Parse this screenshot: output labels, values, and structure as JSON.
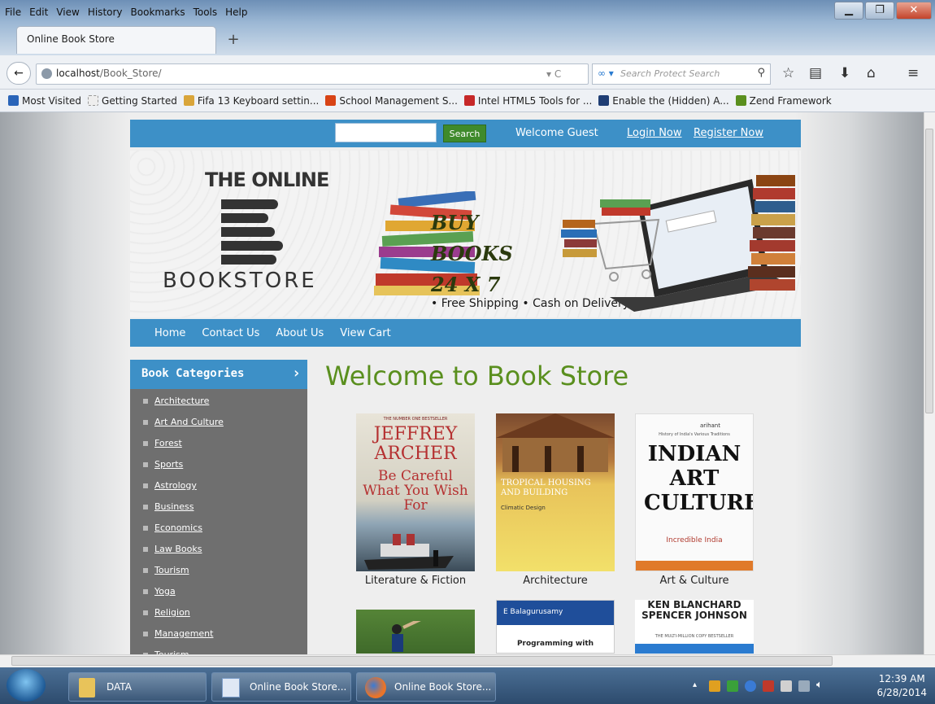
{
  "browser": {
    "menu": [
      "File",
      "Edit",
      "View",
      "History",
      "Bookmarks",
      "Tools",
      "Help"
    ],
    "tab_title": "Online Book Store",
    "url_host": "localhost",
    "url_path": "/Book_Store/",
    "search_placeholder": "Search Protect Search",
    "bookmarks": [
      {
        "label": "Most Visited",
        "color": "#2a64b8"
      },
      {
        "label": "Getting Started",
        "color": "#eeeeee"
      },
      {
        "label": "Fifa 13 Keyboard settin...",
        "color": "#d9a53a"
      },
      {
        "label": "School Management S...",
        "color": "#d84315"
      },
      {
        "label": "Intel HTML5 Tools for ...",
        "color": "#c62828"
      },
      {
        "label": "Enable the (Hidden) A...",
        "color": "#1f3e74"
      },
      {
        "label": "Zend Framework",
        "color": "#5a8f1e"
      }
    ]
  },
  "site": {
    "search_button": "Search",
    "welcome": "Welcome Guest",
    "login": "Login Now",
    "register": "Register Now",
    "logo_top": "THE ONLINE",
    "logo_bottom": "BOOKSTORE",
    "slogan": [
      "BUY",
      "BOOKS",
      "24 X 7"
    ],
    "shipping": "• Free Shipping  • Cash on Delivery",
    "nav": [
      "Home",
      "Contact Us",
      "About Us",
      "View Cart"
    ],
    "categories_title": "Book Categories",
    "categories": [
      "Architecture",
      "Art And Culture",
      "Forest",
      "Sports",
      "Astrology",
      "Business",
      "Economics",
      "Law Books",
      "Tourism",
      "Yoga",
      "Religion",
      "Management",
      "Tourism"
    ],
    "welcome_title": "Welcome to Book Store",
    "books": [
      {
        "caption": "Literature & Fiction",
        "cover_author": "JEFFREY ARCHER",
        "cover_title": "Be Careful What You Wish For",
        "cover_top": "THE NUMBER ONE BESTSELLER"
      },
      {
        "caption": "Architecture",
        "cover_title": "TROPICAL HOUSING AND BUILDING",
        "cover_sub": "Climatic Design"
      },
      {
        "caption": "Art & Culture",
        "cover_title": "INDIAN ART CULTURE",
        "cover_top": "History of India's Various Traditions",
        "cover_brand": "arihant",
        "cover_footer": "Incredible India"
      }
    ],
    "books_row2": [
      {
        "cover_title": ""
      },
      {
        "cover_author": "E Balagurusamy",
        "cover_title": "Programming with"
      },
      {
        "cover_author": "KEN BLANCHARD SPENCER JOHNSON",
        "cover_top": "THE MULTI-MILLION COPY BESTSELLER"
      }
    ]
  },
  "taskbar": {
    "items": [
      "DATA",
      "Online Book Store...",
      "Online Book Store..."
    ],
    "time": "12:39 AM",
    "date": "6/28/2014"
  }
}
